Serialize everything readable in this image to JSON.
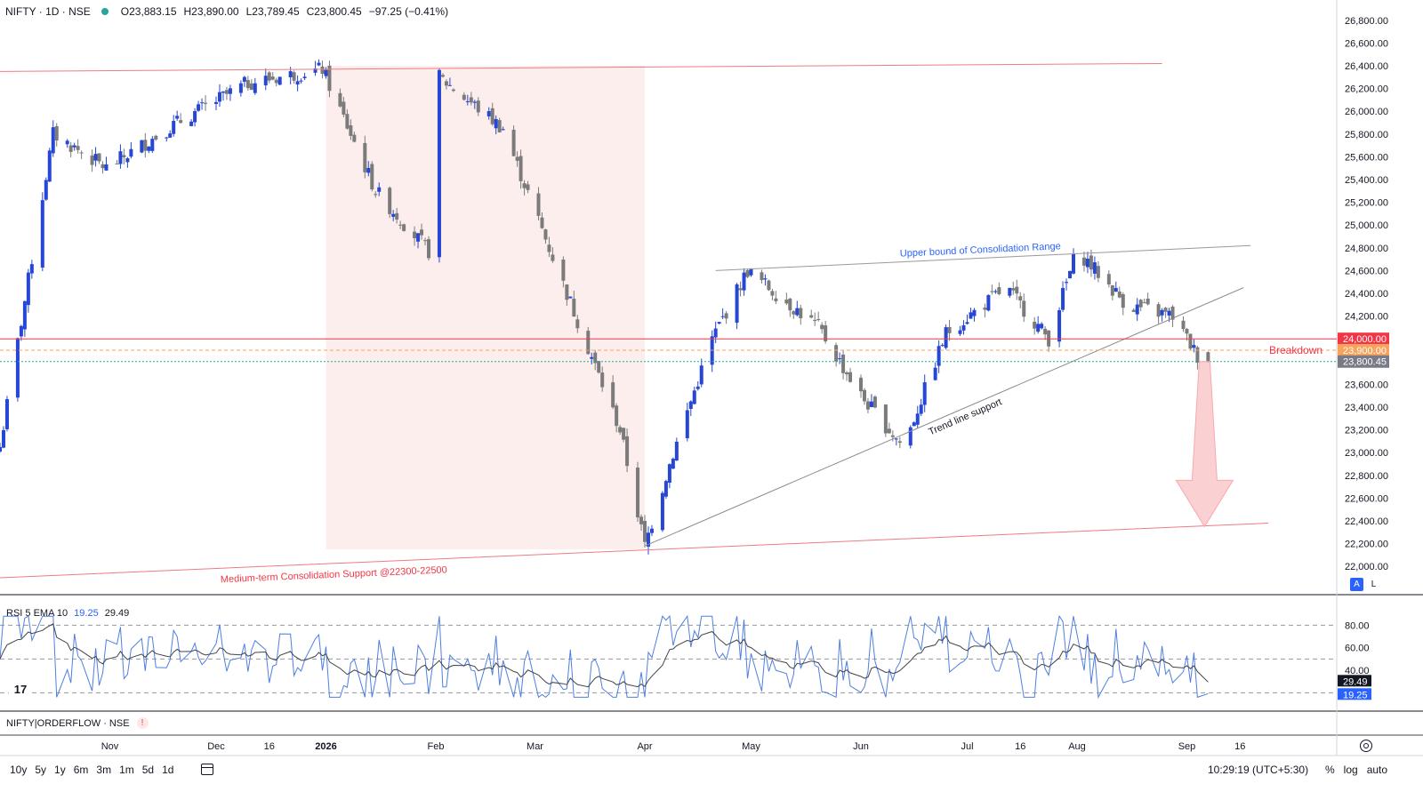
{
  "header": {
    "symbol": "NIFTY · 1D · NSE",
    "status_color": "#26a69a",
    "open": "O23,883.15",
    "high": "H23,890.00",
    "low": "L23,789.45",
    "close": "C23,800.45",
    "change": "−97.25 (−0.41%)"
  },
  "colors": {
    "up": "#2646d6",
    "down": "#7b7b7b",
    "resistance": "#f07b82",
    "rsi": "#4f7fe0",
    "ema": "#444444",
    "band": "#fdeeee",
    "last_price": "#787b86",
    "level_24000": "#f23645",
    "level_23900": "#f7a35c"
  },
  "chart_data": {
    "type": "candlestick",
    "interval": "1D",
    "ylim": [
      21900,
      26900
    ],
    "price_ticks": [
      "22,000.00",
      "22,200.00",
      "22,400.00",
      "22,600.00",
      "22,800.00",
      "23,000.00",
      "23,200.00",
      "23,400.00",
      "23,600.00",
      "23,800.00",
      "24,000.00",
      "24,200.00",
      "24,400.00",
      "24,600.00",
      "24,800.00",
      "25,000.00",
      "25,200.00",
      "25,400.00",
      "25,600.00",
      "25,800.00",
      "26,000.00",
      "26,200.00",
      "26,400.00",
      "26,600.00",
      "26,800.00"
    ],
    "price_tick_values": [
      22000,
      22200,
      22400,
      22600,
      22800,
      23000,
      23200,
      23400,
      23600,
      23800,
      24000,
      24200,
      24400,
      24600,
      24800,
      25000,
      25200,
      25400,
      25600,
      25800,
      26000,
      26200,
      26400,
      26600,
      26800
    ],
    "x_ticks": [
      "Nov",
      "Dec",
      "16",
      "2026",
      "Feb",
      "Mar",
      "Apr",
      "May",
      "Jun",
      "Jul",
      "16",
      "Aug",
      "Sep",
      "16"
    ],
    "x_tick_dates": [
      "2025-11-01",
      "2025-12-01",
      "2025-12-16",
      "2026-01-01",
      "2026-02-01",
      "2026-03-01",
      "2026-04-01",
      "2026-05-01",
      "2026-06-01",
      "2026-07-01",
      "2026-07-16",
      "2026-08-01",
      "2026-09-01",
      "2026-09-16"
    ],
    "anchors": [
      {
        "date": "2025-10-01",
        "close": 23050
      },
      {
        "date": "2025-10-16",
        "close": 25800
      },
      {
        "date": "2025-10-31",
        "close": 25500
      },
      {
        "date": "2025-11-20",
        "close": 25900
      },
      {
        "date": "2025-12-10",
        "close": 26250
      },
      {
        "date": "2025-12-31",
        "close": 26370
      },
      {
        "date": "2026-01-15",
        "close": 25300
      },
      {
        "date": "2026-02-01",
        "close": 24700
      },
      {
        "date": "2026-02-02",
        "close": 26300
      },
      {
        "date": "2026-02-20",
        "close": 25850
      },
      {
        "date": "2026-02-28",
        "close": 25200
      },
      {
        "date": "2026-03-10",
        "close": 24400
      },
      {
        "date": "2026-03-25",
        "close": 23200
      },
      {
        "date": "2026-04-01",
        "close": 22180
      },
      {
        "date": "2026-04-08",
        "close": 22900
      },
      {
        "date": "2026-04-20",
        "close": 24000
      },
      {
        "date": "2026-04-30",
        "close": 24600
      },
      {
        "date": "2026-05-20",
        "close": 24100
      },
      {
        "date": "2026-06-01",
        "close": 23500
      },
      {
        "date": "2026-06-13",
        "close": 23050
      },
      {
        "date": "2026-06-25",
        "close": 24050
      },
      {
        "date": "2026-07-12",
        "close": 24450
      },
      {
        "date": "2026-07-24",
        "close": 24000
      },
      {
        "date": "2026-08-01",
        "close": 24780
      },
      {
        "date": "2026-08-15",
        "close": 24300
      },
      {
        "date": "2026-08-28",
        "close": 24200
      },
      {
        "date": "2026-09-05",
        "close": 23800
      }
    ],
    "last_candle": {
      "open": 23883.15,
      "high": 23890.0,
      "low": 23789.45,
      "close": 23800.45
    },
    "price_labels": [
      {
        "text": "24,000.00",
        "value": 24000,
        "color": "#f23645"
      },
      {
        "text": "23,900.00",
        "value": 23900,
        "color": "#f7a35c"
      },
      {
        "text": "23,800.45",
        "value": 23800.45,
        "color": "#787b86"
      }
    ],
    "resistance_top": {
      "from": {
        "date": "2025-10-01",
        "price": 26350
      },
      "to": {
        "date": "2026-08-25",
        "price": 26420
      }
    },
    "support_line": {
      "from": {
        "date": "2025-10-01",
        "price": 21900
      },
      "to": {
        "date": "2026-09-24",
        "price": 22380
      },
      "label": "Medium-term Consolidation Support @22300-22500"
    },
    "upper_bound": {
      "from": {
        "date": "2026-04-21",
        "price": 24600
      },
      "to": {
        "date": "2026-09-19",
        "price": 24820
      },
      "label": "Upper bound of Consolidation Range"
    },
    "trend_support": {
      "from": {
        "date": "2026-04-01",
        "price": 22180
      },
      "to": {
        "date": "2026-09-17",
        "price": 24450
      },
      "label": "Trend line support"
    },
    "breakdown": {
      "label": "Breakdown",
      "price": 23900
    },
    "shaded_region": {
      "from": "2026-01-01",
      "to": "2026-04-01",
      "price_from": 22150,
      "price_to": 26400
    },
    "target_arrow": {
      "date": "2026-09-06",
      "from_price": 23800,
      "to_price": 22350
    },
    "rsi": {
      "label": "RSI 5 EMA 10",
      "rsi_value": "19.25",
      "ema_value": "29.49",
      "rsi_last": 19.25,
      "ema_last": 29.49,
      "ylim": [
        10,
        100
      ],
      "levels": [
        20,
        50,
        80
      ],
      "ticks": [
        "40.00",
        "60.00",
        "80.00"
      ],
      "tick_values": [
        40,
        60,
        80
      ]
    }
  },
  "orderflow": {
    "label": "NIFTY|ORDERFLOW · NSE",
    "warning": "!"
  },
  "scale_buttons": {
    "auto_label": "A",
    "log_label": "L"
  },
  "bottom": {
    "ranges": [
      "10y",
      "5y",
      "1y",
      "6m",
      "3m",
      "1m",
      "5d",
      "1d"
    ],
    "time": "10:29:19 (UTC+5:30)",
    "percent": "%",
    "log": "log",
    "auto": "auto"
  }
}
